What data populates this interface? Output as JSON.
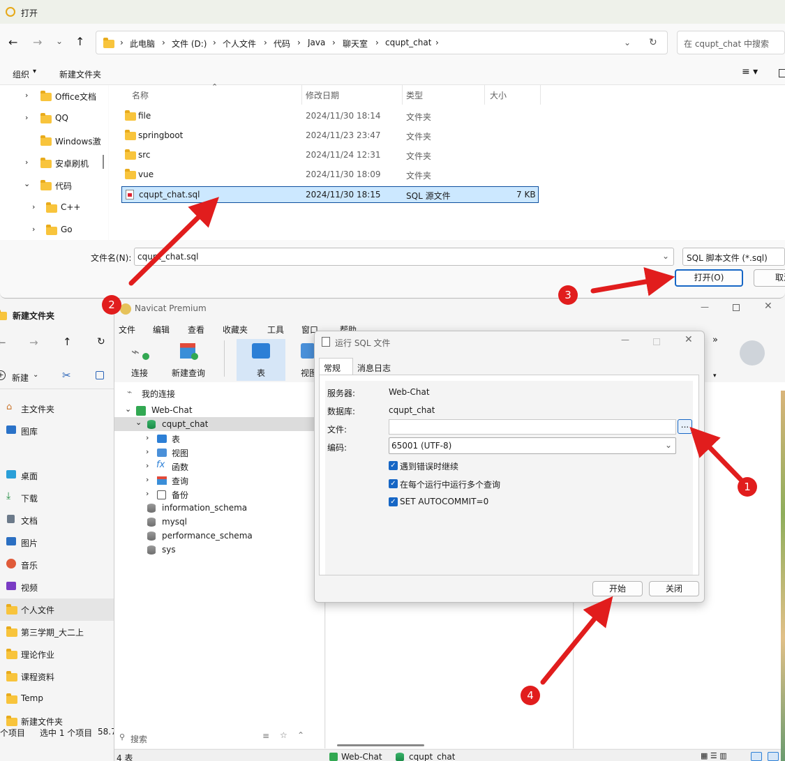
{
  "open_dialog": {
    "title": "打开",
    "path": [
      "此电脑",
      "文件 (D:)",
      "个人文件",
      "代码",
      "Java",
      "聊天室",
      "cqupt_chat"
    ],
    "search_placeholder": "在 cqupt_chat 中搜索",
    "toolbar": {
      "organize": "组织",
      "new_folder": "新建文件夹"
    },
    "columns": {
      "name": "名称",
      "modified": "修改日期",
      "type": "类型",
      "size": "大小"
    },
    "files": [
      {
        "name": "file",
        "modified": "2024/11/30 18:14",
        "type": "文件夹",
        "size": ""
      },
      {
        "name": "springboot",
        "modified": "2024/11/23 23:47",
        "type": "文件夹",
        "size": ""
      },
      {
        "name": "src",
        "modified": "2024/11/24 12:31",
        "type": "文件夹",
        "size": ""
      },
      {
        "name": "vue",
        "modified": "2024/11/30 18:09",
        "type": "文件夹",
        "size": ""
      },
      {
        "name": "cqupt_chat.sql",
        "modified": "2024/11/30 18:15",
        "type": "SQL 源文件",
        "size": "7 KB"
      }
    ],
    "tree": [
      "Office文档",
      "QQ",
      "Windows激",
      "安卓刷机",
      "代码",
      "C++",
      "Go"
    ],
    "filename_label": "文件名(N):",
    "filename_value": "cqupt_chat.sql",
    "filter": "SQL 脚本文件 (*.sql)",
    "open_button": "打开(O)",
    "cancel_button": "取消"
  },
  "explorer": {
    "title": "新建文件夹",
    "new_button": "新建",
    "nav": [
      "主文件夹",
      "图库",
      "桌面",
      "下载",
      "文档",
      "图片",
      "音乐",
      "视频",
      "个人文件",
      "第三学期_大二上",
      "理论作业",
      "课程资料",
      "Temp",
      "新建文件夹"
    ],
    "status": [
      "个项目",
      "选中 1 个项目",
      "58.7"
    ]
  },
  "navicat": {
    "title": "Navicat Premium",
    "menu": [
      "文件",
      "编辑",
      "查看",
      "收藏夹",
      "工具",
      "窗口",
      "帮助"
    ],
    "toolbar": [
      "连接",
      "新建查询",
      "表",
      "视图"
    ],
    "tree": {
      "root": "我的连接",
      "connection": "Web-Chat",
      "database": "cqupt_chat",
      "objects": [
        "表",
        "视图",
        "函数",
        "查询",
        "备份"
      ],
      "other_dbs": [
        "information_schema",
        "mysql",
        "performance_schema",
        "sys"
      ]
    },
    "search_placeholder": "搜索",
    "status_left": "4 表",
    "status_conn": "Web-Chat",
    "status_db": "cqupt_chat"
  },
  "run_sql": {
    "title": "运行 SQL 文件",
    "tabs": [
      "常规",
      "消息日志"
    ],
    "server_label": "服务器:",
    "server_value": "Web-Chat",
    "db_label": "数据库:",
    "db_value": "cqupt_chat",
    "file_label": "文件:",
    "file_value": "",
    "browse_button": "...",
    "encoding_label": "编码:",
    "encoding_value": "65001 (UTF-8)",
    "options": [
      "遇到错误时继续",
      "在每个运行中运行多个查询",
      "SET AUTOCOMMIT=0"
    ],
    "start_button": "开始",
    "close_button": "关闭"
  },
  "annotations": [
    "1",
    "2",
    "3",
    "4"
  ],
  "colors": {
    "arrow": "#e11d1d",
    "accent": "#1666c5",
    "selection": "#cce8ff"
  }
}
